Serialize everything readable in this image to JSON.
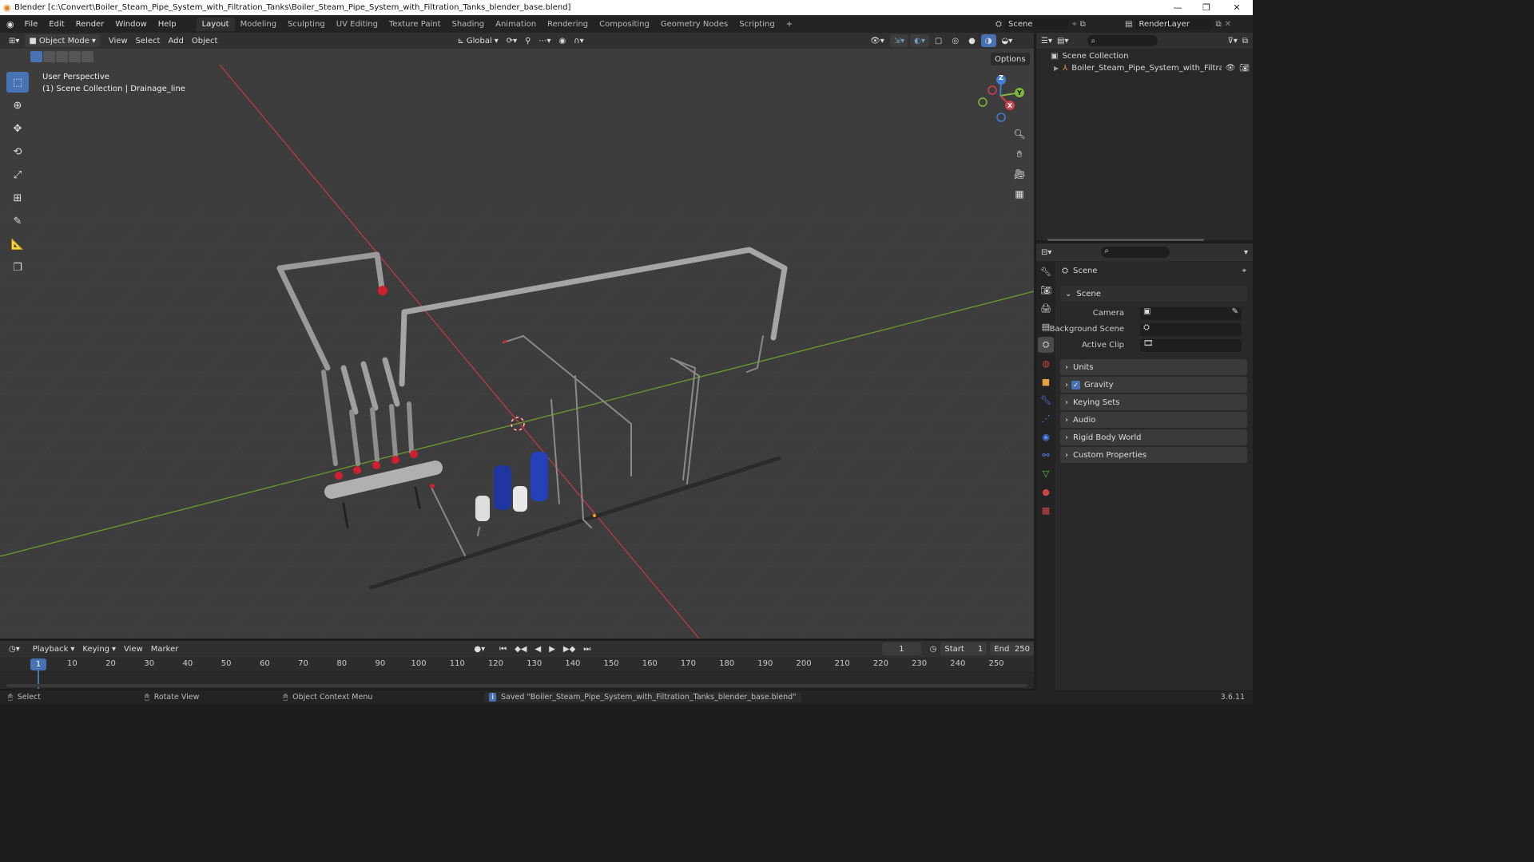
{
  "window": {
    "title": "Blender [c:\\Convert\\Boiler_Steam_Pipe_System_with_Filtration_Tanks\\Boiler_Steam_Pipe_System_with_Filtration_Tanks_blender_base.blend]",
    "minimize": "—",
    "maximize": "❐",
    "close": "✕"
  },
  "menus": [
    "File",
    "Edit",
    "Render",
    "Window",
    "Help"
  ],
  "workspaces": [
    "Layout",
    "Modeling",
    "Sculpting",
    "UV Editing",
    "Texture Paint",
    "Shading",
    "Animation",
    "Rendering",
    "Compositing",
    "Geometry Nodes",
    "Scripting"
  ],
  "active_workspace": "Layout",
  "scene_field": "Scene",
  "view_layer_field": "RenderLayer",
  "viewport_header": {
    "mode": "Object Mode",
    "menus": [
      "View",
      "Select",
      "Add",
      "Object"
    ],
    "transform": "Global",
    "options": "Options"
  },
  "viewport_info": {
    "line1": "User Perspective",
    "line2": "(1) Scene Collection | Drainage_line"
  },
  "gizmo": {
    "z": "Z",
    "y": "Y",
    "x": "X"
  },
  "outliner": {
    "root": "Scene Collection",
    "item": "Boiler_Steam_Pipe_System_with_Filtrat"
  },
  "properties": {
    "header": "Scene",
    "panel_title": "Scene",
    "camera_label": "Camera",
    "bg_scene_label": "Background Scene",
    "active_clip_label": "Active Clip",
    "panels": [
      "Units",
      "Gravity",
      "Keying Sets",
      "Audio",
      "Rigid Body World",
      "Custom Properties"
    ]
  },
  "timeline": {
    "menus": [
      "Playback",
      "Keying",
      "View",
      "Marker"
    ],
    "current_frame": "1",
    "start_label": "Start",
    "start": "1",
    "end_label": "End",
    "end": "250",
    "ruler": [
      "1",
      "10",
      "20",
      "30",
      "40",
      "50",
      "60",
      "70",
      "80",
      "90",
      "100",
      "110",
      "120",
      "130",
      "140",
      "150",
      "160",
      "170",
      "180",
      "190",
      "200",
      "210",
      "220",
      "230",
      "240",
      "250"
    ]
  },
  "status": {
    "select": "Select",
    "rotate": "Rotate View",
    "context": "Object Context Menu",
    "message": "Saved \"Boiler_Steam_Pipe_System_with_Filtration_Tanks_blender_base.blend\"",
    "version": "3.6.11"
  },
  "colors": {
    "accent": "#4772b3",
    "x_axis": "#d04050",
    "y_axis": "#7fb83a",
    "z_axis": "#3f7fd6"
  }
}
